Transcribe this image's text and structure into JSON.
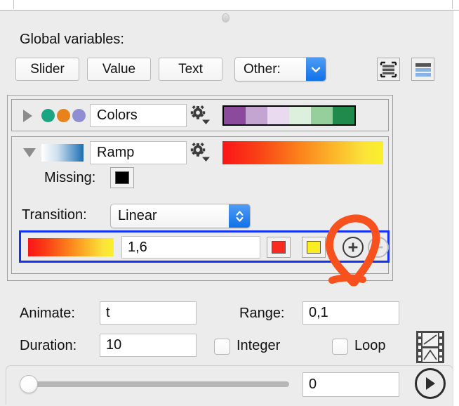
{
  "window": {
    "splitter_grip": "splitter-grip"
  },
  "global_variables": {
    "section_label": "Global variables:",
    "buttons": [
      {
        "name": "slider",
        "label": "Slider"
      },
      {
        "name": "value",
        "label": "Value"
      },
      {
        "name": "text",
        "label": "Text"
      }
    ],
    "other_popup": {
      "label": "Other:",
      "arrow_icon": "chevron-down-icon"
    },
    "view_tools": [
      {
        "name": "list-view",
        "icon": "list-view-icon"
      },
      {
        "name": "table-view",
        "icon": "table-view-icon"
      }
    ]
  },
  "variables": [
    {
      "name": "colors",
      "disclosure": "collapsed",
      "disclosure_icon": "triangle-right-icon",
      "type_icon": "three-dots-icon",
      "dot_colors": [
        "#1aa583",
        "#e8831b",
        "#8f8ed2"
      ],
      "title": "Colors",
      "gear_icon": "gear-menu-icon",
      "preview_colors": [
        "#8b4a9c",
        "#c4a5d2",
        "#e9daef",
        "#dcf0dd",
        "#96cf9b",
        "#1f8a4c"
      ]
    },
    {
      "name": "ramp",
      "disclosure": "expanded",
      "disclosure_icon": "triangle-down-icon",
      "type_icon": "gradient-thumb-icon",
      "thumb_gradient": [
        "#ffffff",
        "#1b6fb5"
      ],
      "title": "Ramp",
      "gear_icon": "gear-menu-icon",
      "preview_gradient": [
        "#fa1418",
        "#fa5a16",
        "#fb9e20",
        "#fbd832",
        "#faf02a"
      ],
      "missing_label": "Missing:",
      "missing_color": "#000000",
      "transition_label": "Transition:",
      "transition_value": "Linear",
      "transition_stepper_icon": "up-down-chevron-icon",
      "selected_stop": {
        "gradient": [
          "#fa1418",
          "#fa5a16",
          "#fb9e20",
          "#fbd832",
          "#faf02a"
        ],
        "value": "1,6",
        "start_color": "#fa2a21",
        "end_color": "#faee22",
        "add_icon": "plus-circle-icon",
        "remove_icon": "minus-circle-icon",
        "add_enabled": true,
        "remove_enabled": false,
        "highlight_color": "#1430f0"
      }
    }
  ],
  "animate": {
    "animate_label": "Animate:",
    "animate_value": "t",
    "range_label": "Range:",
    "range_value": "0,1",
    "duration_label": "Duration:",
    "duration_value": "10",
    "integer_label": "Integer",
    "integer_checked": false,
    "loop_label": "Loop",
    "loop_checked": false,
    "film_icon": "film-strip-icon"
  },
  "playback": {
    "slider_position_percent": 0,
    "current_value": "0",
    "play_icon": "play-button-icon"
  },
  "annotation": {
    "shape": "hand-drawn-circle-with-tail",
    "color": "#f7511e",
    "target": "add-stop-button"
  }
}
